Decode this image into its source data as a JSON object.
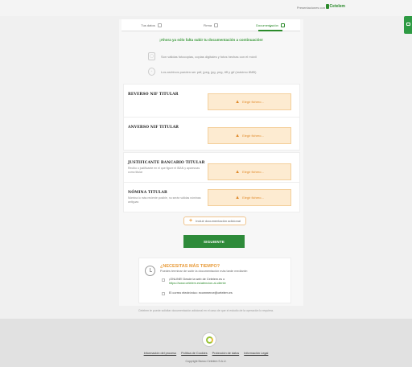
{
  "header": {
    "powered_by": "Presentaciones con",
    "brand": "Cetelem"
  },
  "side_tab": {
    "label": ""
  },
  "steps": [
    {
      "label": "Tus datos"
    },
    {
      "label": "Firma"
    },
    {
      "label": "Documentación"
    }
  ],
  "headline": "¡Ahora ya sólo falta subir tu documentación a continuación!",
  "info": [
    "Son válidas fotocopias, copias digitales y fotos hechas con el móvil",
    "Los archivos pueden ser pdf, jpeg, jpg, png, tiff y gif (máximo 8MB)"
  ],
  "cards": [
    {
      "title": "REVERSO NIF TITULAR",
      "desc": ""
    },
    {
      "title": "ANVERSO NIF TITULAR",
      "desc": ""
    },
    {
      "title": "JUSTIFICANTE BANCARIO TITULAR",
      "desc": "Recibo o justificante en el que figure el IBAN y aparezcas como titular"
    },
    {
      "title": "NÓMINA TITULAR",
      "desc": "Nómina lo más reciente posible, no serán válidas nóminas antiguas"
    }
  ],
  "upload_label": "Elegir fichero...",
  "add_doc_label": "Incluir documentación adicional",
  "next_label": "SIGUIENTE",
  "time_card": {
    "title": "¿NECESITAS MÁS TIEMPO?",
    "subtitle": "Puedes terminar de subir la documentación más tarde mediante:",
    "option1_text": "¡ONLINE! Desde la web de Cetelem.es o",
    "option1_link": "https://www.cetelem.es/atencion-al-cliente",
    "option2_text": "El correo electrónico: ecommerce@cetelem.es"
  },
  "disclaimer": "Cetelem te puede solicitar documentación adicional en el caso de que el estudio de la operación lo requiera.",
  "footer": {
    "links": [
      "Información del proceso",
      "Política de Cookies",
      "Protección de datos",
      "Información Legal"
    ],
    "copyright": "Copyright Banco Cetelem S.A.U."
  },
  "colors": {
    "brand_green": "#2e8b3a",
    "accent_orange": "#e89b3a",
    "upload_bg": "#fdebd1"
  }
}
